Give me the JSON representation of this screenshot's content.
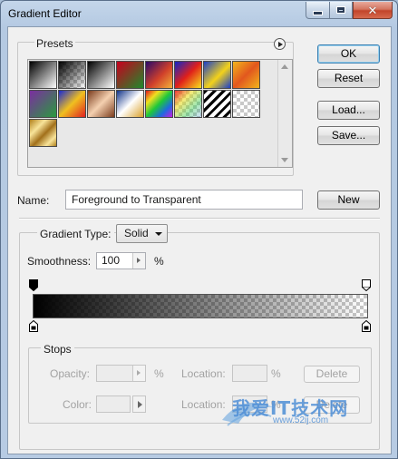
{
  "window": {
    "title": "Gradient Editor",
    "controls": {
      "minimize": "minimize-icon",
      "maximize": "maximize-icon",
      "close": "close-icon"
    }
  },
  "presets": {
    "label": "Presets",
    "menu_icon": "flyout-menu-icon"
  },
  "buttons": {
    "ok": "OK",
    "reset": "Reset",
    "load": "Load...",
    "save": "Save...",
    "new": "New"
  },
  "name": {
    "label": "Name:",
    "value": "Foreground to Transparent"
  },
  "gradient_type": {
    "label": "Gradient Type:",
    "selected": "Solid"
  },
  "smoothness": {
    "label": "Smoothness:",
    "value": "100",
    "unit": "%"
  },
  "gradient": {
    "start_color": "#000000",
    "end_opacity": 0
  },
  "stops": {
    "label": "Stops",
    "opacity_label": "Opacity:",
    "opacity_unit": "%",
    "location_label": "Location:",
    "location_unit": "%",
    "delete_label": "Delete",
    "color_label": "Color:",
    "location2_label": "Location:",
    "location2_unit": "%",
    "delete2_label": "Delete"
  },
  "watermark": {
    "text": "我爱IT技术网",
    "url": "www.52ij.com"
  }
}
